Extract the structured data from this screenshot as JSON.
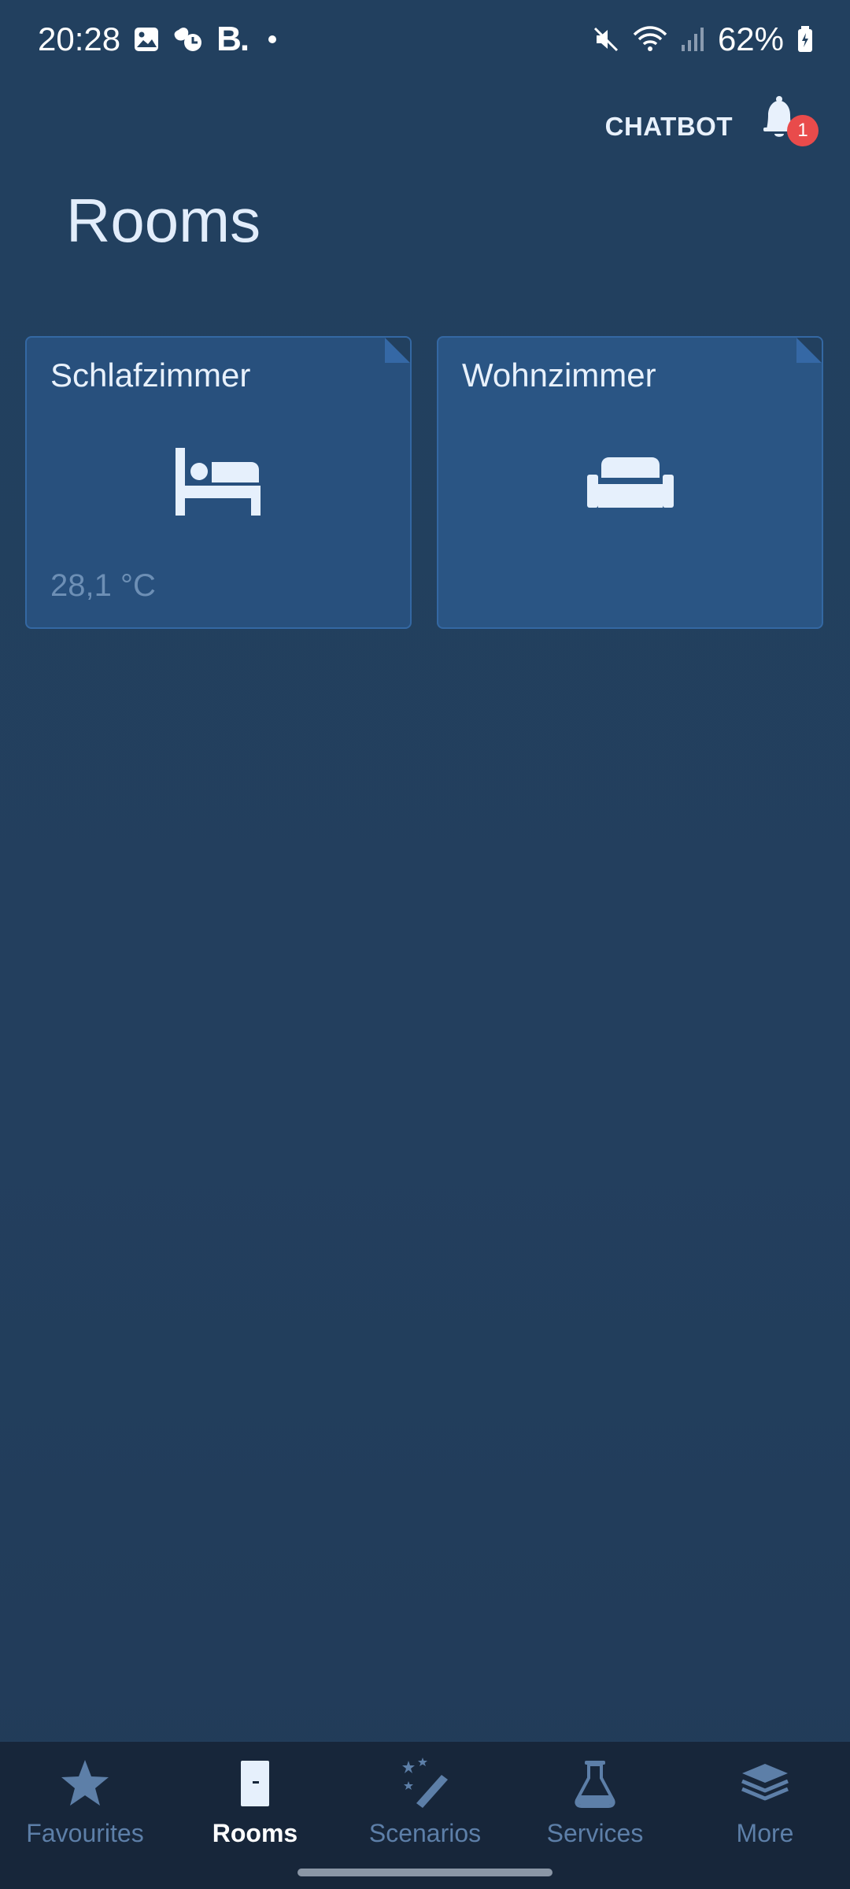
{
  "status_bar": {
    "time": "20:28",
    "brand_letter": "B.",
    "battery": "62%",
    "icons": [
      "image-icon",
      "notification-app-icon",
      "mute-icon",
      "wifi-icon",
      "signal-icon",
      "battery-icon"
    ]
  },
  "header": {
    "chatbot_label": "CHATBOT",
    "notification_count": "1",
    "title": "Rooms"
  },
  "rooms": [
    {
      "name": "Schlafzimmer",
      "icon": "bed-icon",
      "temperature": "28,1 °C"
    },
    {
      "name": "Wohnzimmer",
      "icon": "sofa-icon",
      "temperature": ""
    }
  ],
  "bottom_nav": {
    "items": [
      {
        "label": "Favourites",
        "icon": "star-icon",
        "active": false
      },
      {
        "label": "Rooms",
        "icon": "door-icon",
        "active": true
      },
      {
        "label": "Scenarios",
        "icon": "magic-wand-icon",
        "active": false
      },
      {
        "label": "Services",
        "icon": "flask-icon",
        "active": false
      },
      {
        "label": "More",
        "icon": "layers-icon",
        "active": false
      }
    ]
  },
  "colors": {
    "background": "#22405f",
    "card": "#28507d",
    "card_border": "#3468a3",
    "nav_background": "#17263a",
    "nav_inactive": "#5d7fa8",
    "badge": "#e94b4b"
  }
}
